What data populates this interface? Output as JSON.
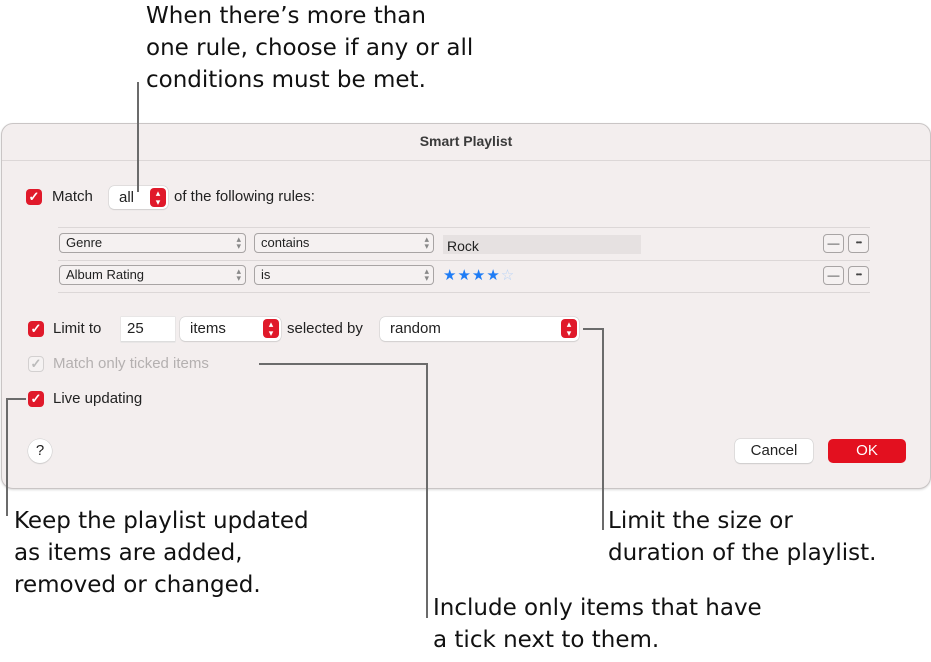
{
  "callouts": {
    "match": "When there’s more than\none rule, choose if any or all\nconditions must be met.",
    "live_updating": "Keep the playlist updated\nas items are added,\nremoved or changed.",
    "ticked": "Include only items that have\na tick next to them.",
    "limit": "Limit the size or\nduration of the playlist."
  },
  "dialog": {
    "title": "Smart Playlist",
    "match": {
      "checked": true,
      "label": "Match",
      "mode": "all",
      "suffix": "of the following rules:"
    },
    "rules": [
      {
        "field": "Genre",
        "operator": "contains",
        "value": "Rock",
        "remove_label": "—",
        "more_label": "•••"
      },
      {
        "field": "Album Rating",
        "operator": "is",
        "value_rating": 4,
        "value_rating_max": 5,
        "stars_on": "★★★★",
        "stars_off": "☆",
        "remove_label": "—",
        "more_label": "•••"
      }
    ],
    "limit": {
      "checked": true,
      "label": "Limit to",
      "value": "25",
      "unit": "items",
      "selected_by_label": "selected by",
      "selected_by": "random"
    },
    "match_ticked": {
      "checked": true,
      "enabled": false,
      "label": "Match only ticked items"
    },
    "live_updating": {
      "checked": true,
      "label": "Live updating"
    },
    "help_label": "?",
    "cancel_label": "Cancel",
    "ok_label": "OK",
    "check_glyph": "✓",
    "stepper_glyph": "⌃⌄",
    "small_arrow_glyph": "⌃⌄"
  },
  "colors": {
    "accent": "#e0192a",
    "star": "#1f7cf5",
    "dialog_bg": "#f3eeee"
  }
}
